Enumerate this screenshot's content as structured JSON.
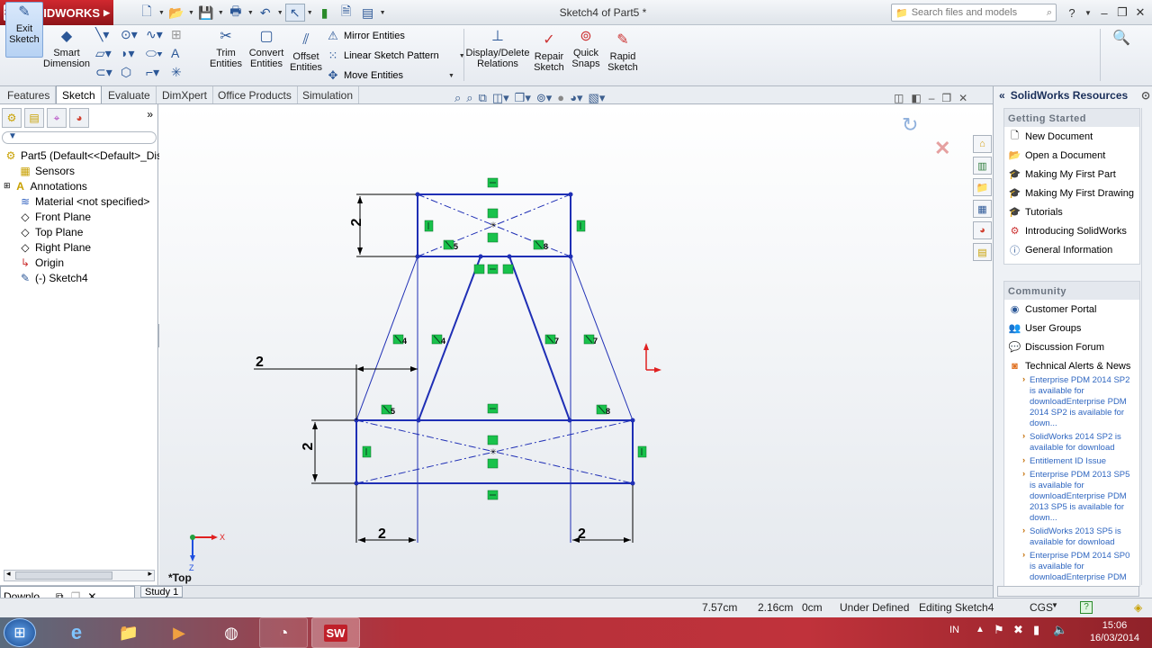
{
  "app": {
    "name": "SOLIDWORKS",
    "doc_title": "Sketch4 of Part5 *",
    "search_placeholder": "Search files and models"
  },
  "ribbon": {
    "exit_sketch": "Exit Sketch",
    "smart_dimension": "Smart Dimension",
    "trim": "Trim Entities",
    "convert": "Convert Entities",
    "offset": "Offset Entities",
    "mirror": "Mirror Entities",
    "linear_pattern": "Linear Sketch Pattern",
    "move": "Move Entities",
    "display_relations": "Display/Delete Relations",
    "repair": "Repair Sketch",
    "quick_snaps": "Quick Snaps",
    "rapid_sketch": "Rapid Sketch"
  },
  "tabs": [
    "Features",
    "Sketch",
    "Evaluate",
    "DimXpert",
    "Office Products",
    "Simulation"
  ],
  "active_tab": "Sketch",
  "tree": {
    "part": "Part5  (Default<<Default>_Disp",
    "items": [
      "Sensors",
      "Annotations",
      "Material <not specified>",
      "Front Plane",
      "Top Plane",
      "Right Plane",
      "Origin",
      "(-) Sketch4"
    ]
  },
  "canvas": {
    "view_label": "*Top",
    "axis_x": "X",
    "axis_z": "Z",
    "dims": [
      "2",
      "2",
      "2",
      "2",
      "2"
    ],
    "relation_labels": [
      "5",
      "8",
      "4",
      "4",
      "7",
      "7",
      "5",
      "8"
    ]
  },
  "taskpane": {
    "title": "SolidWorks Resources",
    "getting_started_header": "Getting Started",
    "getting_started": [
      "New Document",
      "Open a Document",
      "Making My First Part",
      "Making My First Drawing",
      "Tutorials",
      "Introducing SolidWorks",
      "General Information"
    ],
    "community_header": "Community",
    "community": [
      "Customer Portal",
      "User Groups",
      "Discussion Forum",
      "Technical Alerts & News"
    ],
    "news": [
      "Enterprise PDM 2014 SP2 is available for downloadEnterprise PDM 2014 SP2 is available for down...",
      "SolidWorks 2014 SP2 is available for download",
      "Entitlement ID Issue",
      "Enterprise PDM 2013 SP5 is available for downloadEnterprise PDM 2013 SP5 is available for down...",
      "SolidWorks 2013 SP5 is available for download",
      "Enterprise PDM 2014 SP0 is available for downloadEnterprise PDM"
    ]
  },
  "bottom": {
    "model_tab": "Downlo...",
    "study_tab": "Study 1"
  },
  "status": {
    "x": "7.57cm",
    "y": "2.16cm",
    "z": "0cm",
    "state": "Under Defined",
    "editing": "Editing Sketch4",
    "units": "CGS"
  },
  "taskbar": {
    "lang": "IN",
    "time": "15:06",
    "date": "16/03/2014"
  }
}
